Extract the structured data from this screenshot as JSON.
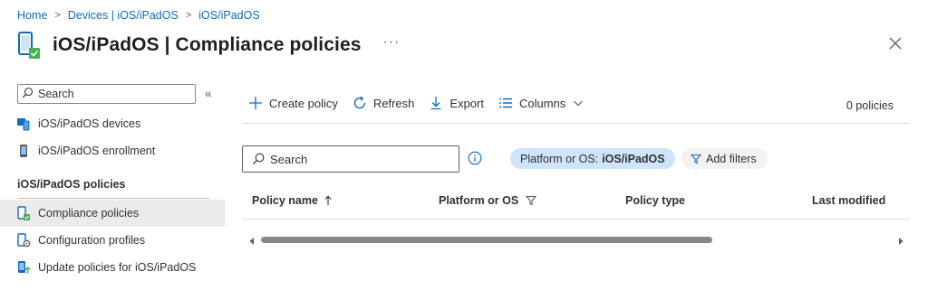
{
  "breadcrumb": {
    "items": [
      "Home",
      "Devices | iOS/iPadOS",
      "iOS/iPadOS"
    ],
    "separator": ">"
  },
  "header": {
    "title_bold": "iOS/iPadOS",
    "title_rest": " | Compliance policies",
    "more": "···"
  },
  "sidebar": {
    "search_placeholder": "Search",
    "collapse": "«",
    "items": [
      {
        "label": "iOS/iPadOS devices",
        "icon": "devices-icon"
      },
      {
        "label": "iOS/iPadOS enrollment",
        "icon": "phone-icon"
      }
    ],
    "section_title": "iOS/iPadOS policies",
    "policy_items": [
      {
        "label": "Compliance policies",
        "icon": "compliance-icon",
        "active": true
      },
      {
        "label": "Configuration profiles",
        "icon": "configuration-icon",
        "active": false
      },
      {
        "label": "Update policies for iOS/iPadOS",
        "icon": "update-icon",
        "active": false
      }
    ]
  },
  "toolbar": {
    "create_label": "Create policy",
    "refresh_label": "Refresh",
    "export_label": "Export",
    "columns_label": "Columns",
    "count": "0 policies"
  },
  "filters": {
    "search_placeholder": "Search",
    "platform_filter_prefix": "Platform or OS:",
    "platform_filter_value": "iOS/iPadOS",
    "add_filters_label": "Add filters"
  },
  "table": {
    "columns": [
      "Policy name",
      "Platform or OS",
      "Policy type",
      "Last modified"
    ]
  },
  "colors": {
    "accent": "#0f6cbd",
    "pill_bg": "#cfe4fa",
    "active_nav_bg": "#edebe9"
  }
}
